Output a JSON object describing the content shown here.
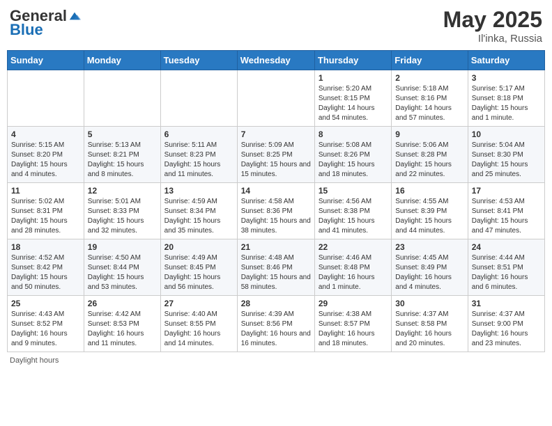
{
  "header": {
    "logo_general": "General",
    "logo_blue": "Blue",
    "title": "May 2025",
    "location": "Il'inka, Russia"
  },
  "footer": {
    "daylight_label": "Daylight hours"
  },
  "weekdays": [
    "Sunday",
    "Monday",
    "Tuesday",
    "Wednesday",
    "Thursday",
    "Friday",
    "Saturday"
  ],
  "weeks": [
    [
      {
        "day": "",
        "info": ""
      },
      {
        "day": "",
        "info": ""
      },
      {
        "day": "",
        "info": ""
      },
      {
        "day": "",
        "info": ""
      },
      {
        "day": "1",
        "info": "Sunrise: 5:20 AM\nSunset: 8:15 PM\nDaylight: 14 hours and 54 minutes."
      },
      {
        "day": "2",
        "info": "Sunrise: 5:18 AM\nSunset: 8:16 PM\nDaylight: 14 hours and 57 minutes."
      },
      {
        "day": "3",
        "info": "Sunrise: 5:17 AM\nSunset: 8:18 PM\nDaylight: 15 hours and 1 minute."
      }
    ],
    [
      {
        "day": "4",
        "info": "Sunrise: 5:15 AM\nSunset: 8:20 PM\nDaylight: 15 hours and 4 minutes."
      },
      {
        "day": "5",
        "info": "Sunrise: 5:13 AM\nSunset: 8:21 PM\nDaylight: 15 hours and 8 minutes."
      },
      {
        "day": "6",
        "info": "Sunrise: 5:11 AM\nSunset: 8:23 PM\nDaylight: 15 hours and 11 minutes."
      },
      {
        "day": "7",
        "info": "Sunrise: 5:09 AM\nSunset: 8:25 PM\nDaylight: 15 hours and 15 minutes."
      },
      {
        "day": "8",
        "info": "Sunrise: 5:08 AM\nSunset: 8:26 PM\nDaylight: 15 hours and 18 minutes."
      },
      {
        "day": "9",
        "info": "Sunrise: 5:06 AM\nSunset: 8:28 PM\nDaylight: 15 hours and 22 minutes."
      },
      {
        "day": "10",
        "info": "Sunrise: 5:04 AM\nSunset: 8:30 PM\nDaylight: 15 hours and 25 minutes."
      }
    ],
    [
      {
        "day": "11",
        "info": "Sunrise: 5:02 AM\nSunset: 8:31 PM\nDaylight: 15 hours and 28 minutes."
      },
      {
        "day": "12",
        "info": "Sunrise: 5:01 AM\nSunset: 8:33 PM\nDaylight: 15 hours and 32 minutes."
      },
      {
        "day": "13",
        "info": "Sunrise: 4:59 AM\nSunset: 8:34 PM\nDaylight: 15 hours and 35 minutes."
      },
      {
        "day": "14",
        "info": "Sunrise: 4:58 AM\nSunset: 8:36 PM\nDaylight: 15 hours and 38 minutes."
      },
      {
        "day": "15",
        "info": "Sunrise: 4:56 AM\nSunset: 8:38 PM\nDaylight: 15 hours and 41 minutes."
      },
      {
        "day": "16",
        "info": "Sunrise: 4:55 AM\nSunset: 8:39 PM\nDaylight: 15 hours and 44 minutes."
      },
      {
        "day": "17",
        "info": "Sunrise: 4:53 AM\nSunset: 8:41 PM\nDaylight: 15 hours and 47 minutes."
      }
    ],
    [
      {
        "day": "18",
        "info": "Sunrise: 4:52 AM\nSunset: 8:42 PM\nDaylight: 15 hours and 50 minutes."
      },
      {
        "day": "19",
        "info": "Sunrise: 4:50 AM\nSunset: 8:44 PM\nDaylight: 15 hours and 53 minutes."
      },
      {
        "day": "20",
        "info": "Sunrise: 4:49 AM\nSunset: 8:45 PM\nDaylight: 15 hours and 56 minutes."
      },
      {
        "day": "21",
        "info": "Sunrise: 4:48 AM\nSunset: 8:46 PM\nDaylight: 15 hours and 58 minutes."
      },
      {
        "day": "22",
        "info": "Sunrise: 4:46 AM\nSunset: 8:48 PM\nDaylight: 16 hours and 1 minute."
      },
      {
        "day": "23",
        "info": "Sunrise: 4:45 AM\nSunset: 8:49 PM\nDaylight: 16 hours and 4 minutes."
      },
      {
        "day": "24",
        "info": "Sunrise: 4:44 AM\nSunset: 8:51 PM\nDaylight: 16 hours and 6 minutes."
      }
    ],
    [
      {
        "day": "25",
        "info": "Sunrise: 4:43 AM\nSunset: 8:52 PM\nDaylight: 16 hours and 9 minutes."
      },
      {
        "day": "26",
        "info": "Sunrise: 4:42 AM\nSunset: 8:53 PM\nDaylight: 16 hours and 11 minutes."
      },
      {
        "day": "27",
        "info": "Sunrise: 4:40 AM\nSunset: 8:55 PM\nDaylight: 16 hours and 14 minutes."
      },
      {
        "day": "28",
        "info": "Sunrise: 4:39 AM\nSunset: 8:56 PM\nDaylight: 16 hours and 16 minutes."
      },
      {
        "day": "29",
        "info": "Sunrise: 4:38 AM\nSunset: 8:57 PM\nDaylight: 16 hours and 18 minutes."
      },
      {
        "day": "30",
        "info": "Sunrise: 4:37 AM\nSunset: 8:58 PM\nDaylight: 16 hours and 20 minutes."
      },
      {
        "day": "31",
        "info": "Sunrise: 4:37 AM\nSunset: 9:00 PM\nDaylight: 16 hours and 23 minutes."
      }
    ]
  ]
}
